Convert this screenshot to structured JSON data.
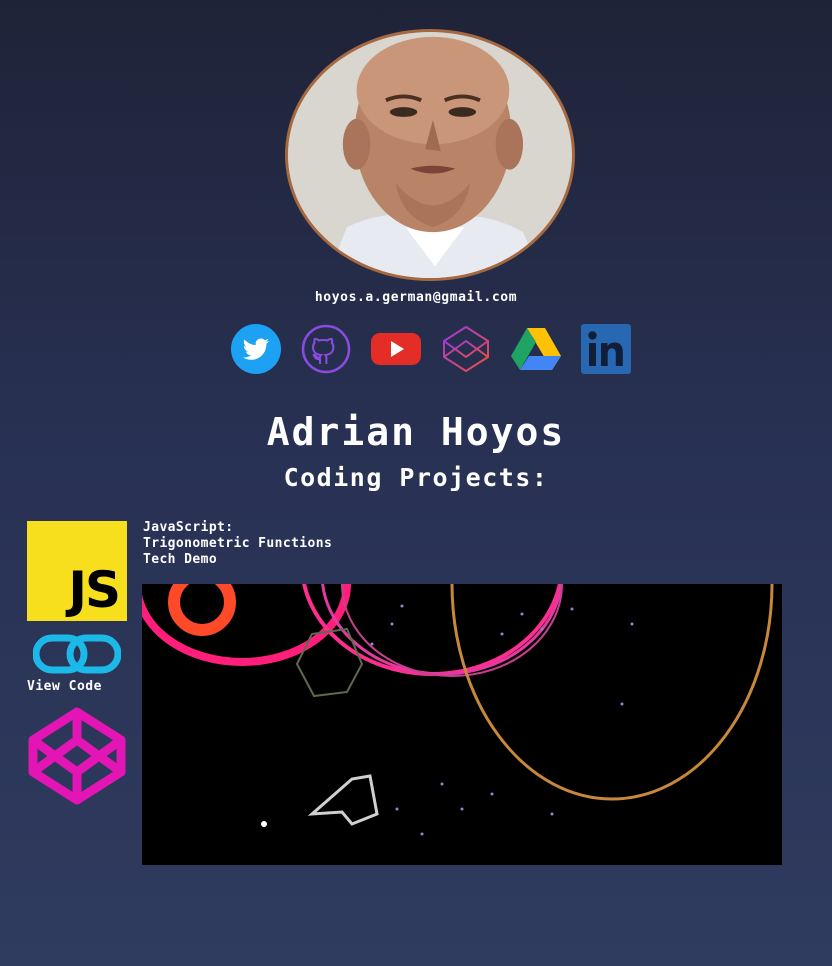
{
  "profile": {
    "email": "hoyos.a.german@gmail.com",
    "name": "Adrian Hoyos",
    "subtitle": "Coding Projects:"
  },
  "socials": [
    {
      "name": "twitter-icon",
      "color": "#1da1f2"
    },
    {
      "name": "github-icon",
      "color": "#8c4be0"
    },
    {
      "name": "youtube-icon",
      "color": "#e52d27"
    },
    {
      "name": "codepen-icon",
      "color": "#c93ad8"
    },
    {
      "name": "google-drive-icon",
      "color": "#1fa463"
    },
    {
      "name": "linkedin-icon",
      "color": "#2867b2"
    }
  ],
  "project": {
    "logo_text": "JS",
    "view_code_label": "View Code",
    "title_lines": [
      "JavaScript:",
      "Trigonometric Functions",
      "Tech Demo"
    ],
    "logo_color": "#f7df1e",
    "link_icon_color": "#1cb8e8",
    "codepen_color": "#e315b4"
  }
}
